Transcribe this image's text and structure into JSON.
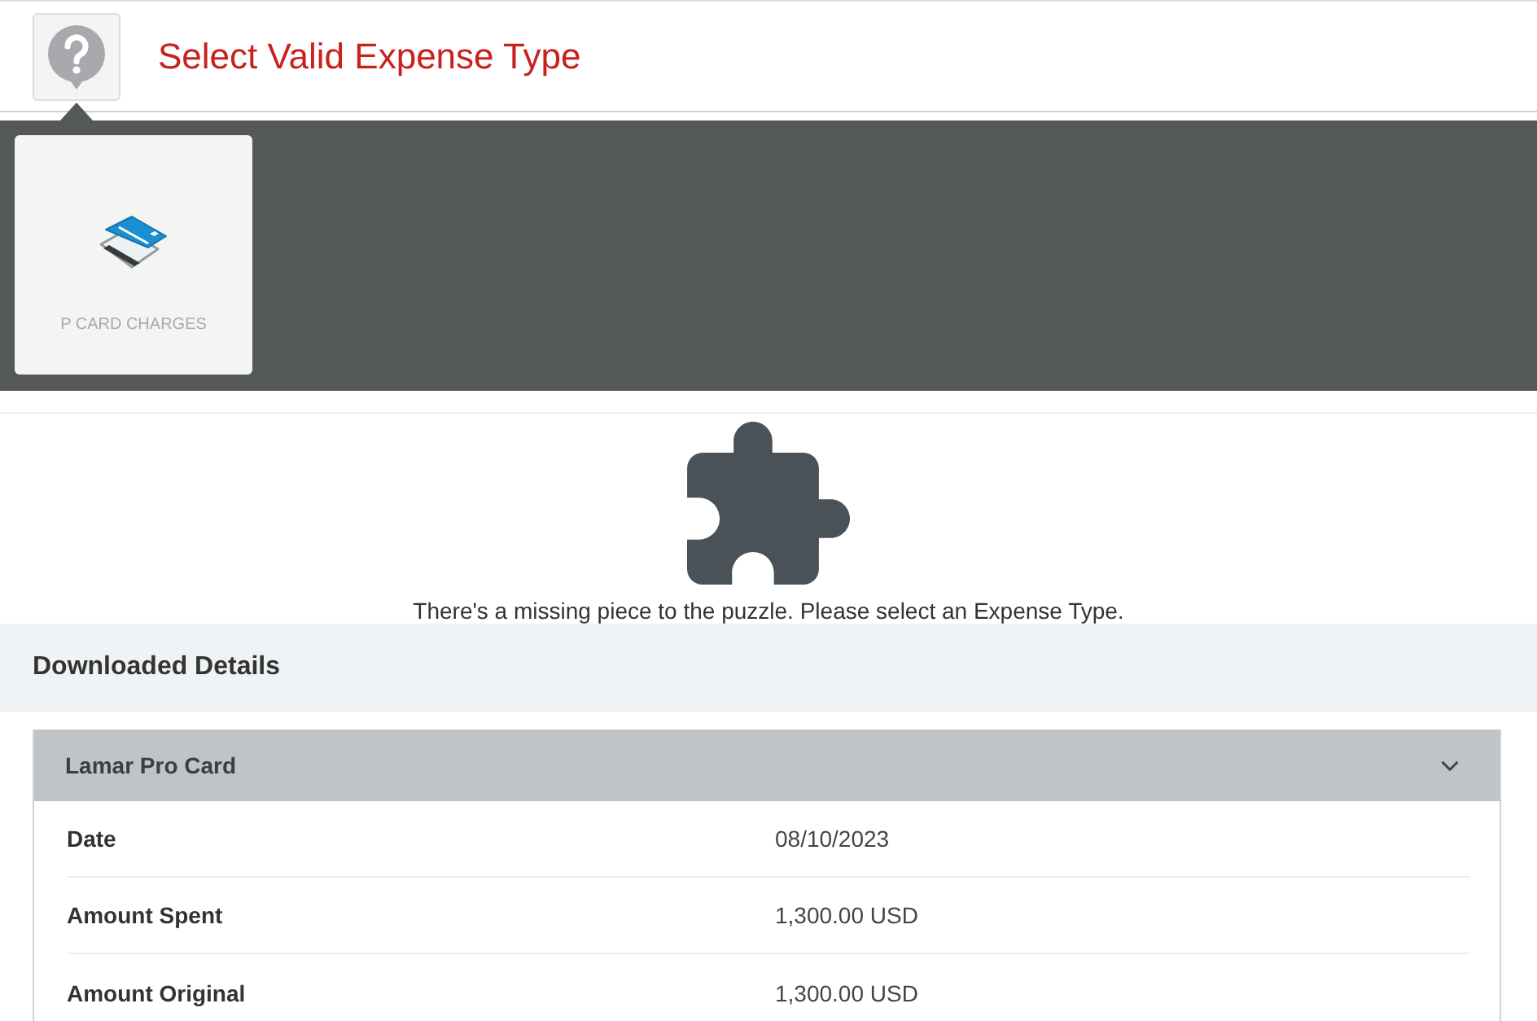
{
  "header": {
    "title": "Select Valid Expense Type"
  },
  "expense_types": [
    {
      "label": "P CARD CHARGES",
      "selected": false
    }
  ],
  "empty_state": {
    "message": "There's a missing piece to the puzzle. Please select an Expense Type."
  },
  "details": {
    "title": "Downloaded Details",
    "card": {
      "title": "Lamar Pro Card",
      "expanded": true,
      "fields": [
        {
          "label": "Date",
          "value": "08/10/2023"
        },
        {
          "label": "Amount Spent",
          "value": "1,300.00 USD"
        },
        {
          "label": "Amount Original",
          "value": "1,300.00 USD"
        }
      ]
    }
  }
}
